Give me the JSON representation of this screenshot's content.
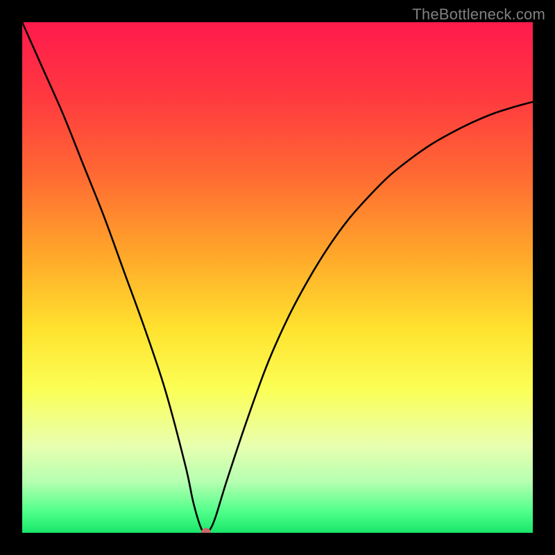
{
  "watermark": "TheBottleneck.com",
  "chart_data": {
    "type": "line",
    "title": "",
    "xlabel": "",
    "ylabel": "",
    "xlim": [
      0,
      100
    ],
    "ylim": [
      0,
      100
    ],
    "grid": false,
    "legend": false,
    "minimum_marker": {
      "x": 36,
      "y": 0,
      "color": "#c86a6a",
      "radius_px": 7
    },
    "curve_description": "V-shaped curve representing bottleneck percentage. Left branch descends nearly linearly from top-left toward the minimum; right branch ascends from the minimum with decreasing slope (concave).",
    "x": [
      0,
      4,
      8,
      12,
      16,
      20,
      24,
      28,
      32,
      33.5,
      35,
      36,
      37,
      38,
      40,
      44,
      48,
      52,
      56,
      60,
      64,
      68,
      72,
      76,
      80,
      84,
      88,
      92,
      96,
      100
    ],
    "y": [
      100,
      91,
      82,
      72,
      62,
      51,
      40,
      28,
      13,
      6,
      1,
      0,
      1,
      3.5,
      10,
      22,
      33,
      42,
      49.5,
      56,
      61.5,
      66,
      70,
      73.2,
      76,
      78.3,
      80.3,
      82,
      83.3,
      84.4
    ],
    "gradient_stops": [
      {
        "offset": 0.0,
        "color": "#ff1a4d"
      },
      {
        "offset": 0.15,
        "color": "#ff3a3f"
      },
      {
        "offset": 0.3,
        "color": "#ff6a33"
      },
      {
        "offset": 0.45,
        "color": "#ffa52a"
      },
      {
        "offset": 0.6,
        "color": "#ffe22e"
      },
      {
        "offset": 0.72,
        "color": "#fbff56"
      },
      {
        "offset": 0.83,
        "color": "#e8ffb0"
      },
      {
        "offset": 0.9,
        "color": "#b6ffb1"
      },
      {
        "offset": 0.96,
        "color": "#4dff88"
      },
      {
        "offset": 1.0,
        "color": "#19e66a"
      }
    ]
  }
}
